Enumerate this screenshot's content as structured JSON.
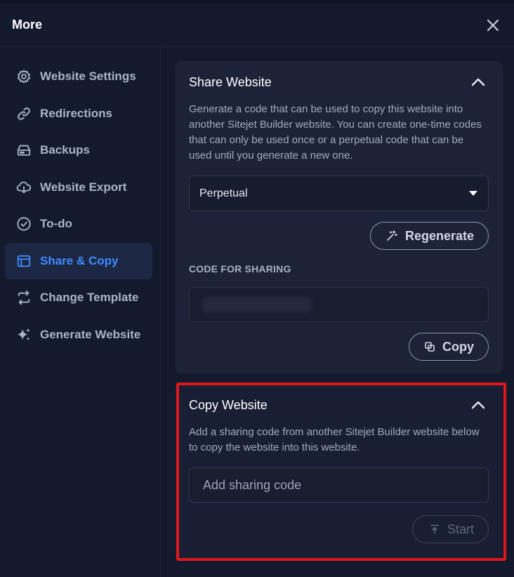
{
  "header": {
    "title": "More"
  },
  "sidebar": {
    "items": [
      {
        "label": "Website Settings",
        "icon": "gear-icon",
        "active": false
      },
      {
        "label": "Redirections",
        "icon": "link-icon",
        "active": false
      },
      {
        "label": "Backups",
        "icon": "hard-drive-icon",
        "active": false
      },
      {
        "label": "Website Export",
        "icon": "cloud-download-icon",
        "active": false
      },
      {
        "label": "To-do",
        "icon": "check-circle-icon",
        "active": false
      },
      {
        "label": "Share & Copy",
        "icon": "browser-window-icon",
        "active": true
      },
      {
        "label": "Change Template",
        "icon": "swap-arrows-icon",
        "active": false
      },
      {
        "label": "Generate Website",
        "icon": "sparkles-icon",
        "active": false
      }
    ]
  },
  "share": {
    "title": "Share Website",
    "description": "Generate a code that can be used to copy this website into another Sitejet Builder website. You can create one-time codes that can only be used once or a perpetual code that can be used until you generate a new one.",
    "select_value": "Perpetual",
    "regenerate_label": "Regenerate",
    "code_label": "CODE FOR SHARING",
    "copy_label": "Copy"
  },
  "copy": {
    "title": "Copy Website",
    "description": "Add a sharing code from another Sitejet Builder website below to copy the website into this website.",
    "input_placeholder": "Add sharing code",
    "input_value": "",
    "start_label": "Start"
  },
  "colors": {
    "background": "#141a2e",
    "panel": "#1c2238",
    "accent": "#3f8cff",
    "highlight": "#e0161e"
  }
}
